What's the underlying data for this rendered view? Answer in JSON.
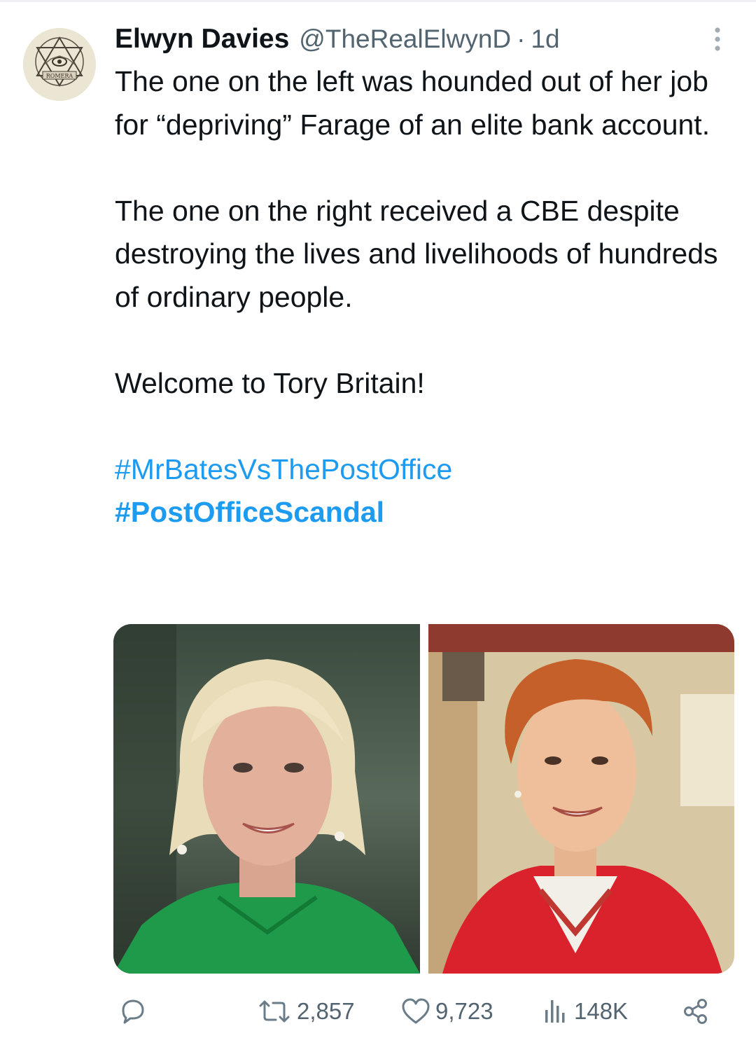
{
  "tweet": {
    "author_name": "Elwyn Davies",
    "handle": "@TheRealElwynD",
    "separator": "·",
    "time": "1d",
    "paragraphs": [
      "The one on the left was hounded out of her job for “depriving” Farage of an elite bank account.",
      "The one on the right received a CBE despite destroying the lives and livelihoods of hundreds of ordinary people.",
      "Welcome to Tory Britain!"
    ],
    "hashtags": [
      "#MrBatesVsThePostOffice",
      "#PostOfficeScandal"
    ],
    "avatar_text": "ROMERA"
  },
  "actions": {
    "reply_icon": "reply-icon",
    "retweet_count": "2,857",
    "like_count": "9,723",
    "views_count": "148K",
    "share_icon": "share-icon"
  },
  "colors": {
    "link": "#1d9bf0",
    "secondary_text": "#536471",
    "primary_text": "#0f1419"
  }
}
